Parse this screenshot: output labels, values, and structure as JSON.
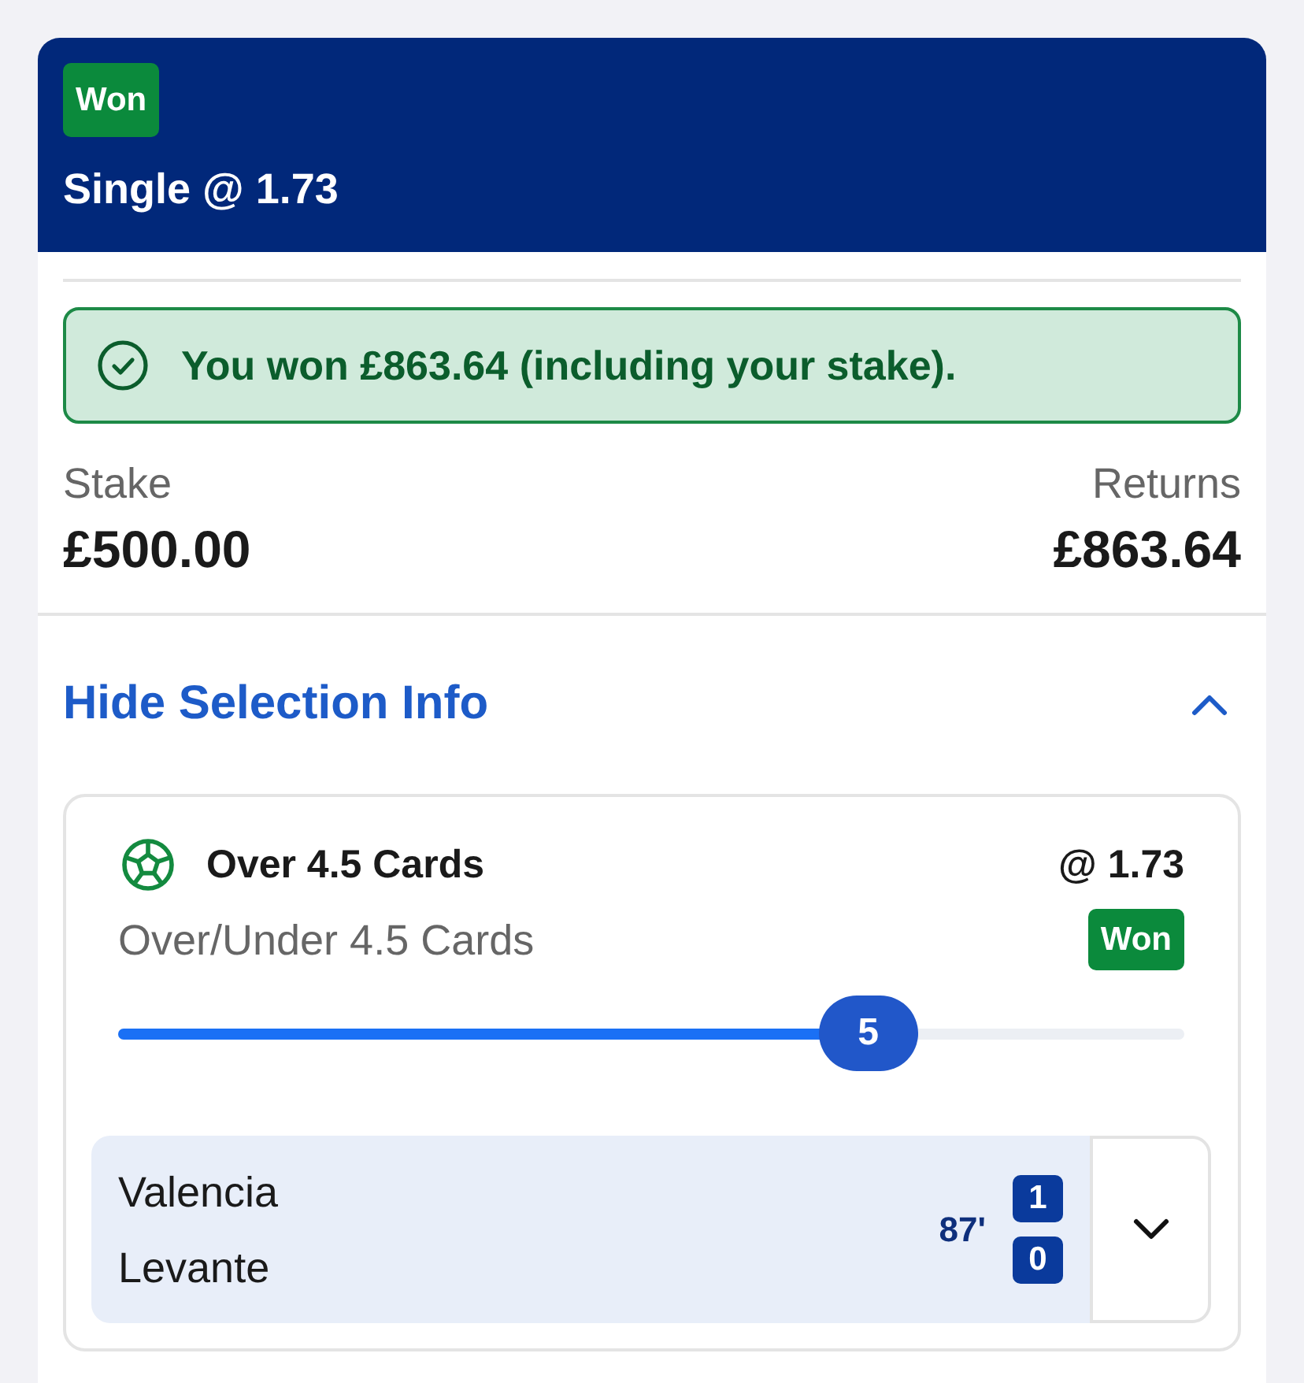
{
  "bet": {
    "status_badge": "Won",
    "title": "Single @ 1.73"
  },
  "result_banner": {
    "message": "You won £863.64 (including your stake)."
  },
  "summary": [
    {
      "label": "Stake",
      "value": "£500.00"
    },
    {
      "label": "Returns",
      "value": "£863.64"
    }
  ],
  "selection_info": {
    "toggle_label": "Hide Selection Info",
    "expanded": true,
    "selection": {
      "name": "Over 4.5 Cards",
      "odds": "@ 1.73",
      "market": "Over/Under 4.5 Cards",
      "status_badge": "Won",
      "progress": {
        "level": 0.75,
        "reading": "5"
      },
      "match": {
        "clock": "87'",
        "expanded": false,
        "teams": [
          {
            "name": "Valencia",
            "score": "1"
          },
          {
            "name": "Levante",
            "score": "0"
          }
        ]
      }
    }
  }
}
